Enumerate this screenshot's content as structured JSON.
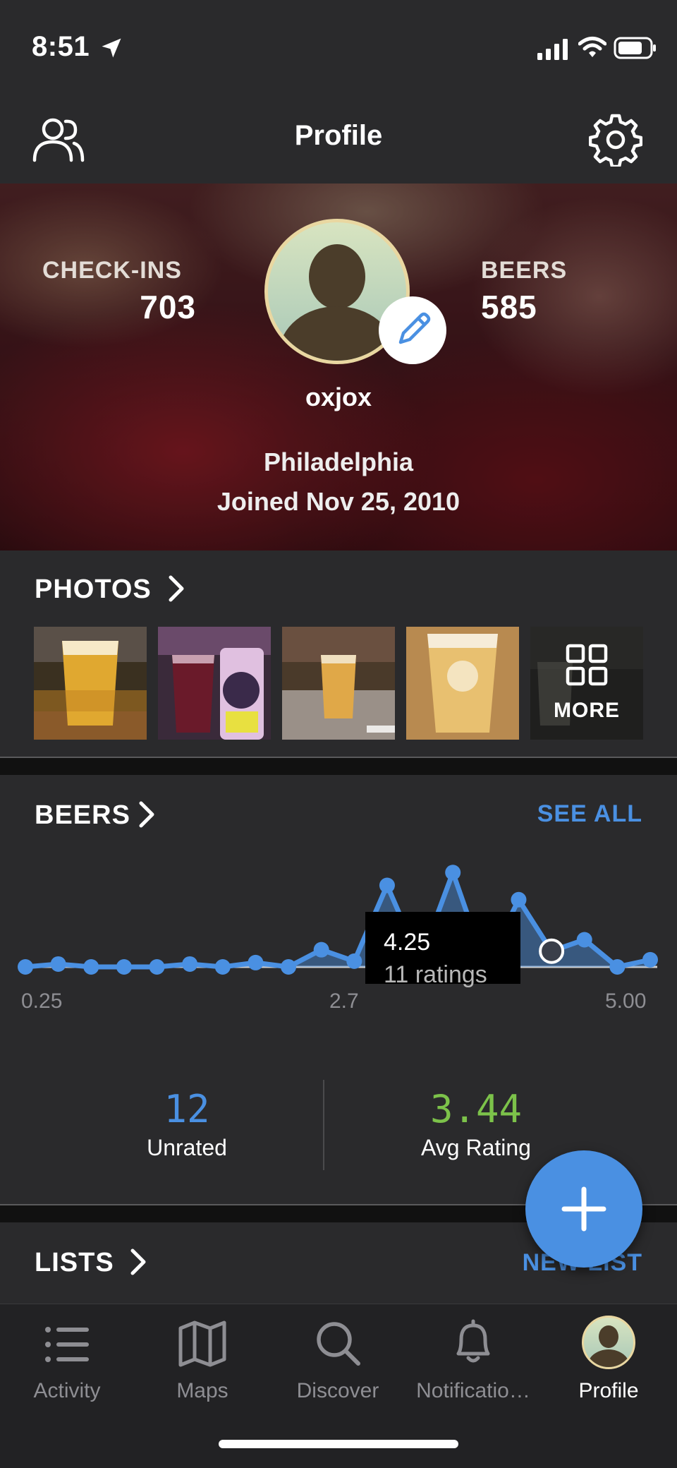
{
  "status_bar": {
    "time": "8:51",
    "icons": [
      "location-arrow-icon",
      "cellular-signal-icon",
      "wifi-icon",
      "battery-icon"
    ]
  },
  "header": {
    "title": "Profile",
    "left_icon": "friends-icon",
    "right_icon": "gear-icon"
  },
  "profile": {
    "checkins_label": "CHECK-INS",
    "checkins_value": "703",
    "beers_label": "BEERS",
    "beers_value": "585",
    "username": "oxjox",
    "location": "Philadelphia",
    "joined": "Joined Nov 25, 2010",
    "edit_icon": "pencil-icon"
  },
  "photos": {
    "title": "PHOTOS",
    "more_label": "MORE",
    "more_icon": "grid-icon"
  },
  "beers": {
    "title": "BEERS",
    "see_all": "SEE ALL",
    "unrated_value": "12",
    "unrated_label": "Unrated",
    "avg_value": "3.44",
    "avg_label": "Avg Rating",
    "tooltip": {
      "value": "4.25",
      "ratings": "11 ratings"
    }
  },
  "lists": {
    "title": "LISTS",
    "new_list": "NEW LIST"
  },
  "tabs": [
    {
      "label": "Activity",
      "icon": "list-icon",
      "active": false
    },
    {
      "label": "Maps",
      "icon": "map-icon",
      "active": false
    },
    {
      "label": "Discover",
      "icon": "search-icon",
      "active": false
    },
    {
      "label": "Notificatio…",
      "icon": "bell-icon",
      "active": false
    },
    {
      "label": "Profile",
      "icon": "avatar",
      "active": true
    }
  ],
  "colors": {
    "accent": "#4a90e2",
    "green": "#7cc24a",
    "background": "#2a2a2c"
  },
  "chart_data": {
    "type": "area",
    "xlabel": "",
    "ylabel": "",
    "tick_labels": [
      "0.25",
      "2.7",
      "5.00"
    ],
    "x": [
      0.25,
      0.5,
      0.75,
      1.0,
      1.25,
      1.5,
      1.75,
      2.0,
      2.25,
      2.5,
      2.75,
      3.0,
      3.25,
      3.5,
      3.75,
      4.0,
      4.25,
      4.5,
      4.75,
      5.0
    ],
    "series": [
      {
        "values": [
          0,
          2,
          0,
          0,
          0,
          2,
          0,
          3,
          0,
          12,
          4,
          57,
          4,
          66,
          0,
          47,
          11,
          19,
          0,
          5
        ]
      }
    ],
    "highlight": {
      "x": 4.25,
      "ratings": 11
    },
    "xlim": [
      0.25,
      5.0
    ],
    "ylim": [
      0,
      75
    ],
    "grid": false,
    "legend": "none"
  }
}
